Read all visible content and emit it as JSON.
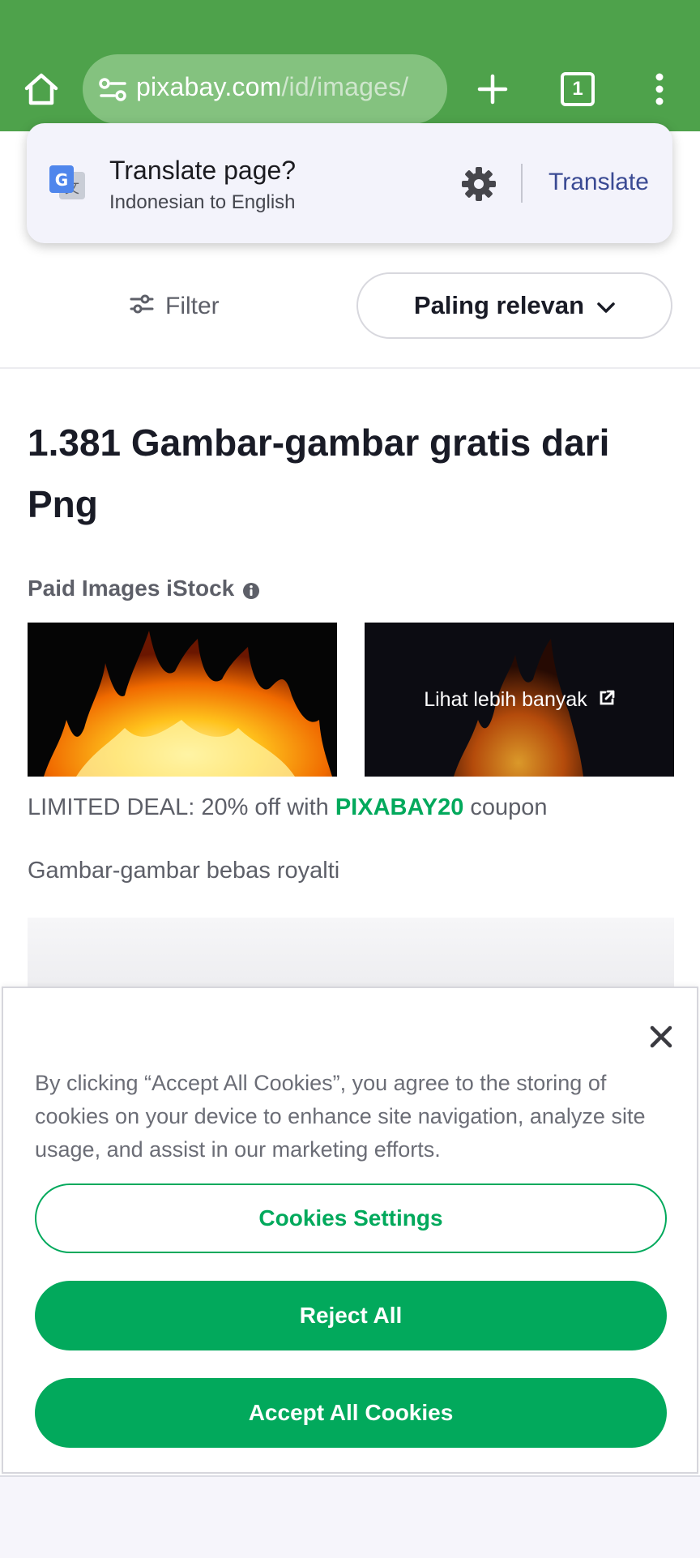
{
  "browser": {
    "url_domain": "pixabay.com",
    "url_path": "/id/images/",
    "tab_count": "1"
  },
  "translate": {
    "title": "Translate page?",
    "subtitle": "Indonesian to English",
    "action": "Translate"
  },
  "toolbar": {
    "filter_label": "Filter",
    "sort_label": "Paling relevan"
  },
  "main": {
    "heading": "1.381 Gambar-gambar gratis dari Png",
    "paid_label": "Paid Images iStock",
    "more_label": "Lihat lebih banyak",
    "deal_prefix": "LIMITED DEAL: 20% off with ",
    "deal_code": "PIXABAY20",
    "deal_suffix": " coupon",
    "royalty_label": "Gambar-gambar bebas royalti"
  },
  "cookie": {
    "text": "By clicking “Accept All Cookies”, you agree to the storing of cookies on your device to enhance site navigation, analyze site usage, and assist in our marketing efforts.",
    "settings_label": "Cookies Settings",
    "reject_label": "Reject All",
    "accept_label": "Accept All Cookies"
  },
  "colors": {
    "chrome_green": "#4ea24b",
    "brand_green": "#02a95c",
    "translate_blue": "#3a4a93"
  }
}
